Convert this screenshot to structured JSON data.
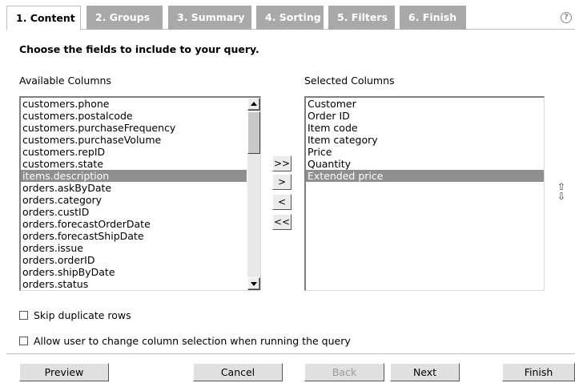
{
  "tabs": [
    {
      "label": "1. Content",
      "active": true
    },
    {
      "label": "2. Groups"
    },
    {
      "label": "3. Summary"
    },
    {
      "label": "4. Sorting"
    },
    {
      "label": "5. Filters"
    },
    {
      "label": "6. Finish"
    }
  ],
  "help_icon": "question-circle-icon",
  "instruction": "Choose the fields to include to your query.",
  "available": {
    "label": "Available Columns",
    "items": [
      "customers.phone",
      "customers.postalcode",
      "customers.purchaseFrequency",
      "customers.purchaseVolume",
      "customers.repID",
      "customers.state",
      "items.description",
      "orders.askByDate",
      "orders.category",
      "orders.custID",
      "orders.forecastOrderDate",
      "orders.forecastShipDate",
      "orders.issue",
      "orders.orderID",
      "orders.shipByDate",
      "orders.status"
    ],
    "selected": "items.description"
  },
  "selected_columns": {
    "label": "Selected Columns",
    "items": [
      "Customer",
      "Order ID",
      "Item code",
      "Item category",
      "Price",
      "Quantity",
      "Extended price"
    ],
    "selected": "Extended price"
  },
  "move_buttons": {
    "add_all": ">>",
    "add": ">",
    "remove": "<",
    "remove_all": "<<"
  },
  "reorder_icons": {
    "up": "⇧",
    "down": "⇩"
  },
  "options": {
    "skip_duplicates": {
      "label": "Skip duplicate rows",
      "checked": false
    },
    "allow_change": {
      "label": "Allow user to change column selection when running the query",
      "checked": false
    }
  },
  "footer": {
    "preview": "Preview",
    "cancel": "Cancel",
    "back": "Back",
    "next": "Next",
    "finish": "Finish"
  },
  "colors": {
    "tab_inactive": "#a9a9a9",
    "selection": "#8f8f8f",
    "button_face": "#e0e0e0"
  }
}
